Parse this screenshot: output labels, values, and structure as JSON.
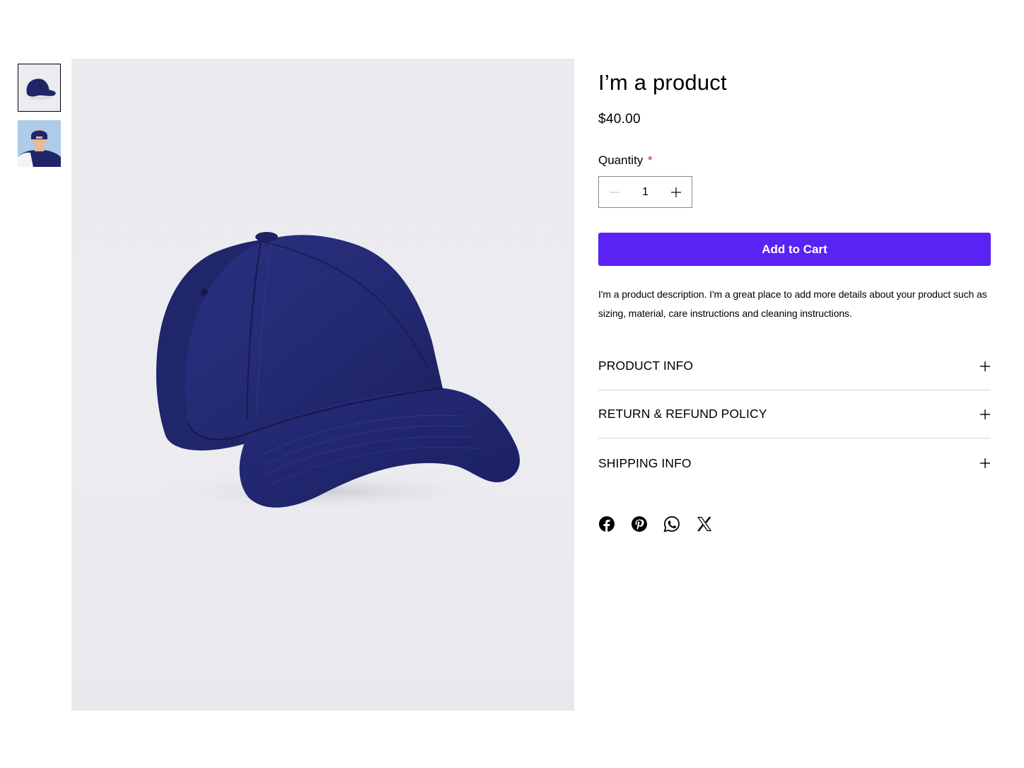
{
  "gallery": {
    "thumbnails": [
      {
        "icon": "cap-side-thumbnail",
        "selected": true
      },
      {
        "icon": "person-wearing-cap-thumbnail",
        "selected": false
      }
    ],
    "main_image": "navy-baseball-cap"
  },
  "product": {
    "title": "I’m a product",
    "price": "$40.00",
    "quantity_label": "Quantity",
    "required_marker": "*",
    "quantity_value": "1",
    "add_to_cart_label": "Add to Cart",
    "description": "I'm a product description. I'm a great place to add more details about your product such as sizing, material, care instructions and cleaning instructions."
  },
  "accordions": [
    {
      "label": "PRODUCT INFO",
      "icon": "plus-icon"
    },
    {
      "label": "RETURN & REFUND POLICY",
      "icon": "plus-icon"
    },
    {
      "label": "SHIPPING INFO",
      "icon": "plus-icon"
    }
  ],
  "social": [
    "facebook-icon",
    "pinterest-icon",
    "whatsapp-icon",
    "x-icon"
  ],
  "colors": {
    "accent": "#5a23f5",
    "required": "#d6192d",
    "cap": "#1f2566",
    "image_bg": "#ececf0"
  }
}
